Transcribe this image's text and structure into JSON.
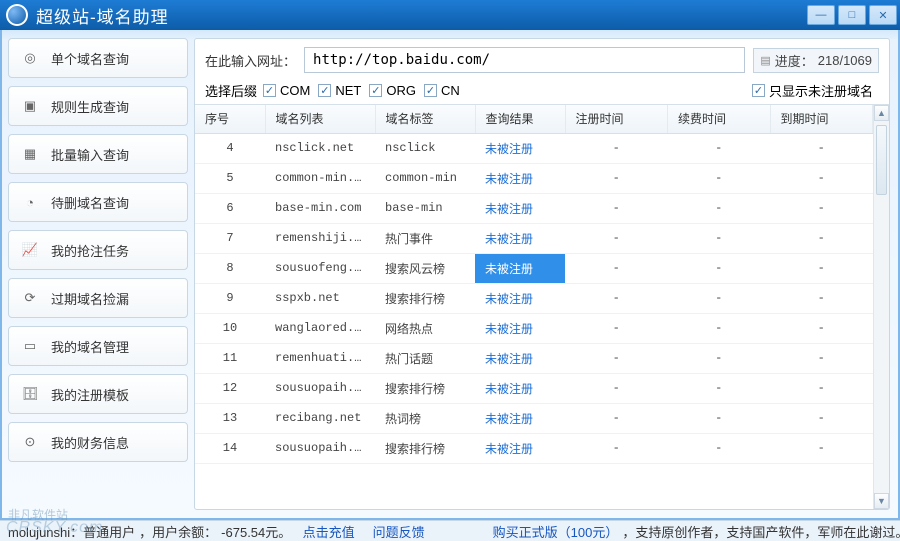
{
  "window": {
    "title": "超级站-域名助理"
  },
  "sidebar": {
    "items": [
      {
        "label": "单个域名查询",
        "icon": "target-icon"
      },
      {
        "label": "规则生成查询",
        "icon": "presentation-icon"
      },
      {
        "label": "批量输入查询",
        "icon": "grid-icon"
      },
      {
        "label": "待删域名查询",
        "icon": "stopwatch-icon"
      },
      {
        "label": "我的抢注任务",
        "icon": "chart-icon"
      },
      {
        "label": "过期域名捡漏",
        "icon": "recycle-icon"
      },
      {
        "label": "我的域名管理",
        "icon": "layers-icon"
      },
      {
        "label": "我的注册模板",
        "icon": "drawer-icon"
      },
      {
        "label": "我的财务信息",
        "icon": "coin-icon"
      }
    ]
  },
  "topbar": {
    "url_label": "在此输入网址：",
    "url_value": "http://top.baidu.com/",
    "progress_label": "进度：",
    "progress_value": "218/1069",
    "suffix_label": "选择后缀",
    "suffixes": [
      {
        "label": "COM",
        "checked": true
      },
      {
        "label": "NET",
        "checked": true
      },
      {
        "label": "ORG",
        "checked": true
      },
      {
        "label": "CN",
        "checked": true
      }
    ],
    "only_unregistered": "只显示未注册域名",
    "only_unregistered_checked": true
  },
  "table": {
    "columns": [
      "序号",
      "域名列表",
      "域名标签",
      "查询结果",
      "注册时间",
      "续费时间",
      "到期时间"
    ],
    "rows": [
      {
        "no": "4",
        "domain": "nsclick.net",
        "tag": "nsclick",
        "result": "未被注册",
        "t1": "-",
        "t2": "-",
        "t3": "-",
        "sel": false
      },
      {
        "no": "5",
        "domain": "common-min...",
        "tag": "common-min",
        "result": "未被注册",
        "t1": "-",
        "t2": "-",
        "t3": "-",
        "sel": false
      },
      {
        "no": "6",
        "domain": "base-min.com",
        "tag": "base-min",
        "result": "未被注册",
        "t1": "-",
        "t2": "-",
        "t3": "-",
        "sel": false
      },
      {
        "no": "7",
        "domain": "remenshiji...",
        "tag": "热门事件",
        "result": "未被注册",
        "t1": "-",
        "t2": "-",
        "t3": "-",
        "sel": false
      },
      {
        "no": "8",
        "domain": "sousuofeng...",
        "tag": "搜索风云榜",
        "result": "未被注册",
        "t1": "-",
        "t2": "-",
        "t3": "-",
        "sel": true
      },
      {
        "no": "9",
        "domain": "sspxb.net",
        "tag": "搜索排行榜",
        "result": "未被注册",
        "t1": "-",
        "t2": "-",
        "t3": "-",
        "sel": false
      },
      {
        "no": "10",
        "domain": "wanglaored...",
        "tag": "网络热点",
        "result": "未被注册",
        "t1": "-",
        "t2": "-",
        "t3": "-",
        "sel": false
      },
      {
        "no": "11",
        "domain": "remenhuati...",
        "tag": "热门话题",
        "result": "未被注册",
        "t1": "-",
        "t2": "-",
        "t3": "-",
        "sel": false
      },
      {
        "no": "12",
        "domain": "sousuopaih...",
        "tag": "搜索排行榜",
        "result": "未被注册",
        "t1": "-",
        "t2": "-",
        "t3": "-",
        "sel": false
      },
      {
        "no": "13",
        "domain": "recibang.net",
        "tag": "热词榜",
        "result": "未被注册",
        "t1": "-",
        "t2": "-",
        "t3": "-",
        "sel": false
      },
      {
        "no": "14",
        "domain": "sousuopaih...",
        "tag": "搜索排行榜",
        "result": "未被注册",
        "t1": "-",
        "t2": "-",
        "t3": "-",
        "sel": false
      }
    ]
  },
  "statusbar": {
    "user": "molujunshi：普通用户",
    "balance_label": "，用户余额：",
    "balance": "-675.54元。",
    "recharge": "点击充值",
    "feedback": "问题反馈",
    "buy": "购买正式版（100元）",
    "tail": "，支持原创作者，支持国产软件，军师在此谢过。"
  },
  "watermark": {
    "brand": "非凡软件站",
    "domain": "CRSKY.com"
  }
}
